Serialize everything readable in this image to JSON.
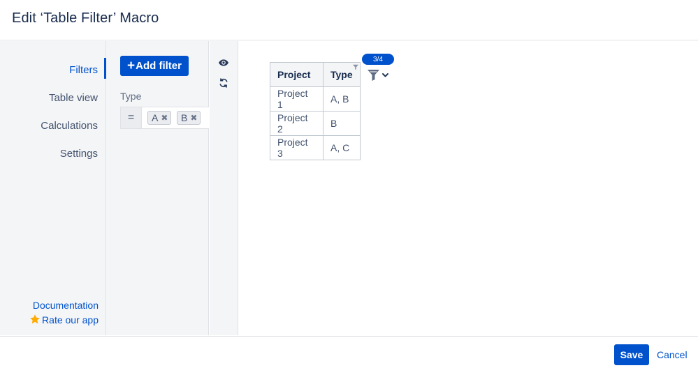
{
  "dialog": {
    "title": "Edit ‘Table Filter’ Macro"
  },
  "sidebar": {
    "items": [
      {
        "label": "Filters",
        "active": true
      },
      {
        "label": "Table view",
        "active": false
      },
      {
        "label": "Calculations",
        "active": false
      },
      {
        "label": "Settings",
        "active": false
      }
    ],
    "documentation_label": "Documentation",
    "rate_label": "Rate our app"
  },
  "filters": {
    "add_filter_label": "Add filter",
    "filter_column_label": "Type",
    "operator": "=",
    "tags": [
      "A",
      "B"
    ]
  },
  "tools": {
    "icons": [
      "eye-icon",
      "refresh-icon"
    ]
  },
  "preview": {
    "headers": [
      "Project",
      "Type"
    ],
    "rows": [
      [
        "Project 1",
        "A, B"
      ],
      [
        "Project 2",
        "B"
      ],
      [
        "Project 3",
        "A, C"
      ]
    ],
    "row_count_badge": "3/4"
  },
  "footer": {
    "save_label": "Save",
    "cancel_label": "Cancel"
  },
  "colors": {
    "accent": "#0052cc",
    "panel_bg": "#f4f5f7",
    "text": "#172b4d",
    "star": "#ffab00"
  }
}
